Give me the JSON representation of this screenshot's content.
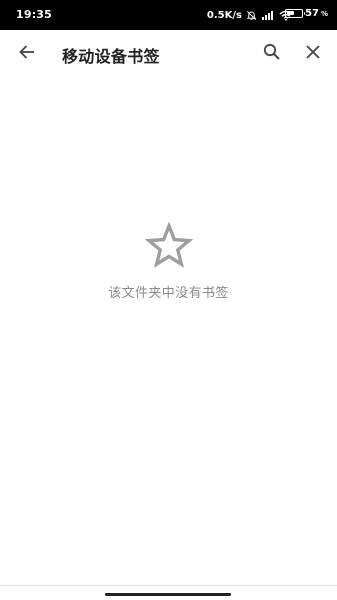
{
  "status_bar": {
    "time": "19:35",
    "network_speed": "0.5K/s",
    "battery_percent": "57",
    "battery_level": 0.57,
    "icons": [
      "mute-icon",
      "signal-icon",
      "wifi-icon",
      "battery-icon"
    ]
  },
  "app_bar": {
    "title": "移动设备书签",
    "icons": {
      "back": "arrow-left-icon",
      "search": "search-icon",
      "close": "close-icon"
    }
  },
  "empty_state": {
    "icon": "star-outline-icon",
    "message": "该文件夹中没有书签"
  },
  "colors": {
    "status_bar_bg": "#000000",
    "title": "#202124",
    "icon": "#444444",
    "empty_icon": "#9e9e9e",
    "empty_text": "#8a8a8a"
  }
}
